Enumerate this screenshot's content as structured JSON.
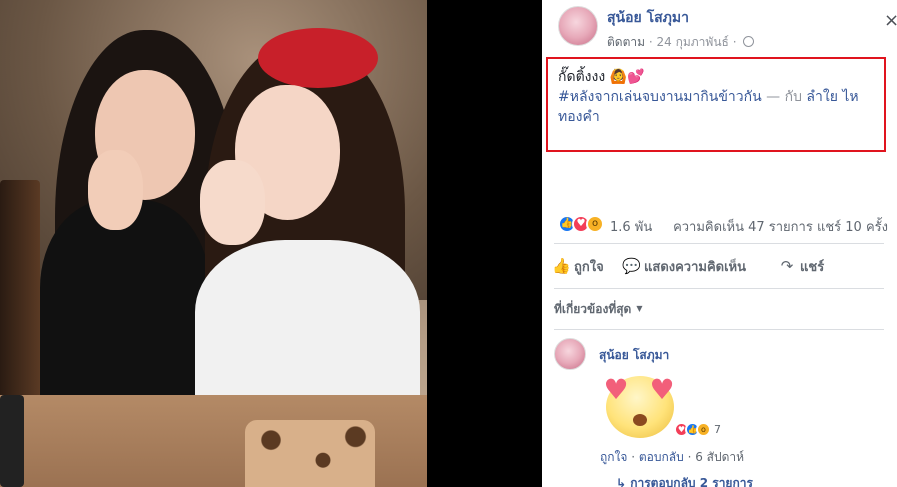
{
  "post": {
    "author": "สุน้อย โสภุมา",
    "follow_label": "ติดตาม",
    "date": "24 กุมภาพันธ์",
    "close_glyph": "×",
    "text_line1": "กั๊ดติ้งงง 🙆💕",
    "hashtag": "#หลังจากเล่นจบงานมากินข้าวกัน",
    "dash": "—",
    "with_label": "กับ",
    "friend": "ลำใย ไหทองคำ"
  },
  "stats": {
    "reactions_count": "1.6 พัน",
    "comments": "ความคิดเห็น 47 รายการ",
    "shares": "แชร์ 10 ครั้ง"
  },
  "actions": {
    "like": "ถูกใจ",
    "comment": "แสดงความคิดเห็น",
    "share": "แชร์"
  },
  "filter": {
    "label": "ที่เกี่ยวข้องที่สุด"
  },
  "comment": {
    "author": "สุน้อย โสภุมา",
    "reactions_count": "7",
    "like_link": "ถูกใจ",
    "reply_link": "ตอบกลับ",
    "time": "6 สัปดาห์",
    "replies": "การตอบกลับ 2 รายการ"
  },
  "colors": {
    "link_blue": "#385898",
    "highlight_red": "#e0141e",
    "like_blue": "#1877f2",
    "love_red": "#f33e58",
    "wow_yellow": "#f7b125"
  }
}
